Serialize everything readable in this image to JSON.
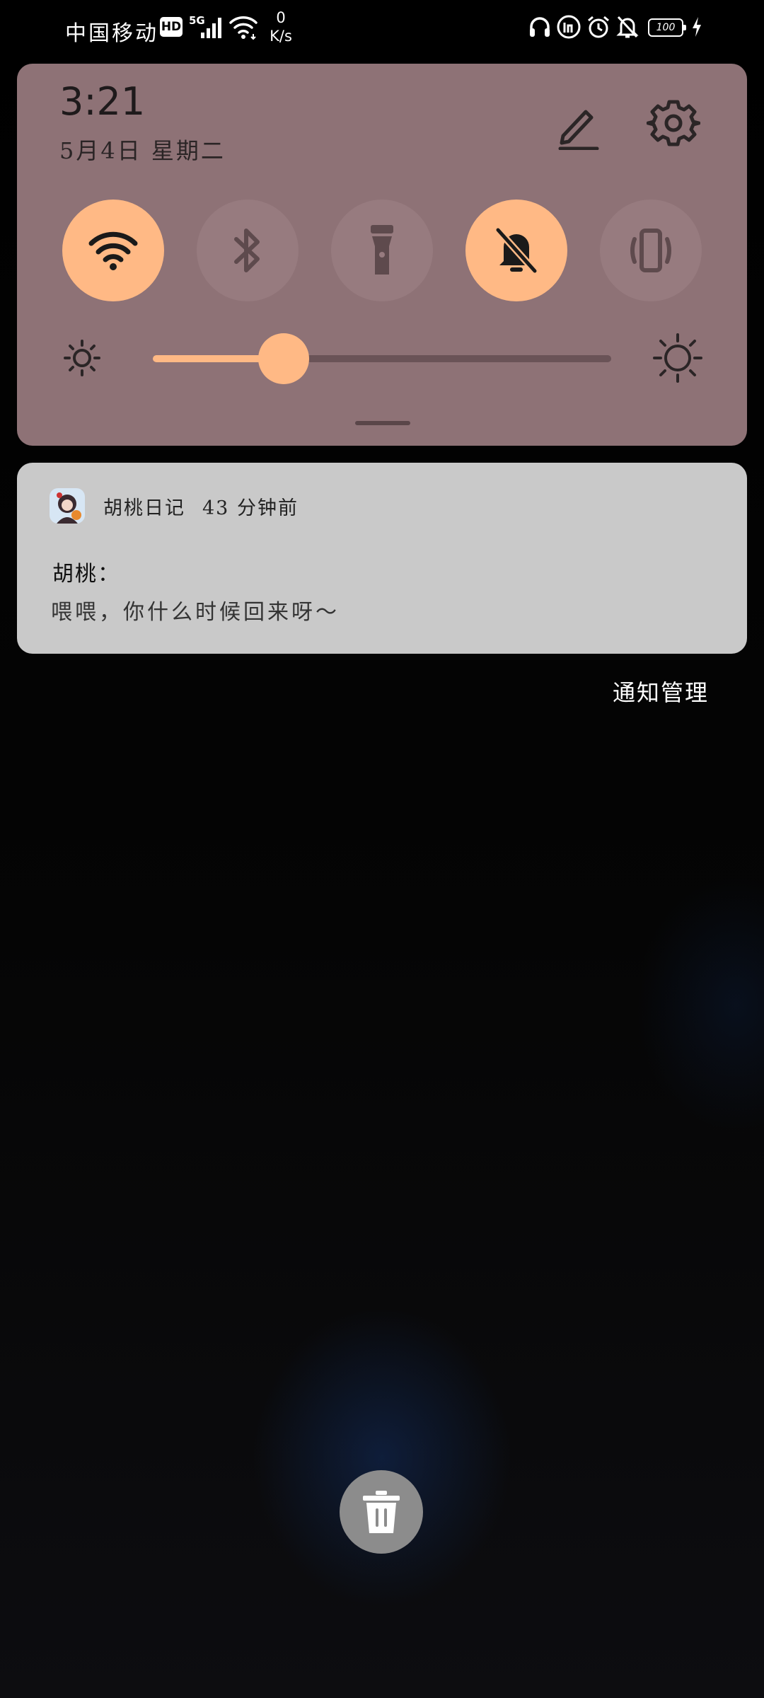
{
  "status_bar": {
    "carrier": "中国移动",
    "hd_badge": "HD",
    "network_type": "5G",
    "net_speed_value": "0",
    "net_speed_unit": "K/s",
    "battery_level": "100",
    "icons": [
      "headset-icon",
      "speed-badge-icon",
      "alarm-icon",
      "bell-off-icon",
      "battery-icon",
      "charging-icon"
    ]
  },
  "quick_settings": {
    "time": "3:21",
    "date": "5月4日 星期二",
    "tiles": [
      {
        "name": "wifi",
        "state": "on",
        "icon": "wifi-icon"
      },
      {
        "name": "bluetooth",
        "state": "off",
        "icon": "bluetooth-icon"
      },
      {
        "name": "flashlight",
        "state": "off",
        "icon": "flashlight-icon"
      },
      {
        "name": "silent",
        "state": "on",
        "icon": "bell-off-icon"
      },
      {
        "name": "vibrate",
        "state": "off",
        "icon": "vibrate-icon"
      }
    ],
    "brightness_level": 0.285,
    "colors": {
      "panel": "#8e7276",
      "accent": "#ffb985",
      "tile_off": "#977b7f"
    }
  },
  "notification": {
    "app_name": "胡桃日记",
    "time_ago": "43 分钟前",
    "title": "胡桃：",
    "body": "喂喂，你什么时候回来呀～"
  },
  "manage_label": "通知管理",
  "clear_button_icon": "trash-icon"
}
